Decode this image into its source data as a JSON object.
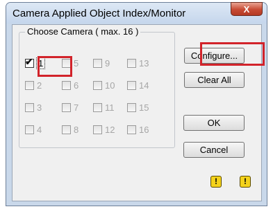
{
  "window": {
    "title": "Camera Applied Object Index/Monitor",
    "close_label": "X"
  },
  "group": {
    "legend": "Choose Camera ( max. 16 )"
  },
  "cameras": [
    {
      "label": "1",
      "checked": true,
      "enabled": true
    },
    {
      "label": "2",
      "checked": false,
      "enabled": false
    },
    {
      "label": "3",
      "checked": false,
      "enabled": false
    },
    {
      "label": "4",
      "checked": false,
      "enabled": false
    },
    {
      "label": "5",
      "checked": false,
      "enabled": false
    },
    {
      "label": "6",
      "checked": false,
      "enabled": false
    },
    {
      "label": "7",
      "checked": false,
      "enabled": false
    },
    {
      "label": "8",
      "checked": false,
      "enabled": false
    },
    {
      "label": "9",
      "checked": false,
      "enabled": false
    },
    {
      "label": "10",
      "checked": false,
      "enabled": false
    },
    {
      "label": "11",
      "checked": false,
      "enabled": false
    },
    {
      "label": "12",
      "checked": false,
      "enabled": false
    },
    {
      "label": "13",
      "checked": false,
      "enabled": false
    },
    {
      "label": "14",
      "checked": false,
      "enabled": false
    },
    {
      "label": "15",
      "checked": false,
      "enabled": false
    },
    {
      "label": "16",
      "checked": false,
      "enabled": false
    }
  ],
  "buttons": {
    "configure": "Configure...",
    "clear_all": "Clear All",
    "ok": "OK",
    "cancel": "Cancel"
  },
  "icons": {
    "warning_glyph": "!",
    "warning_icon": "warning-icon"
  },
  "colors": {
    "highlight": "#d2232a",
    "close": "#c74a33",
    "disabled_text": "#a6a6a6"
  }
}
